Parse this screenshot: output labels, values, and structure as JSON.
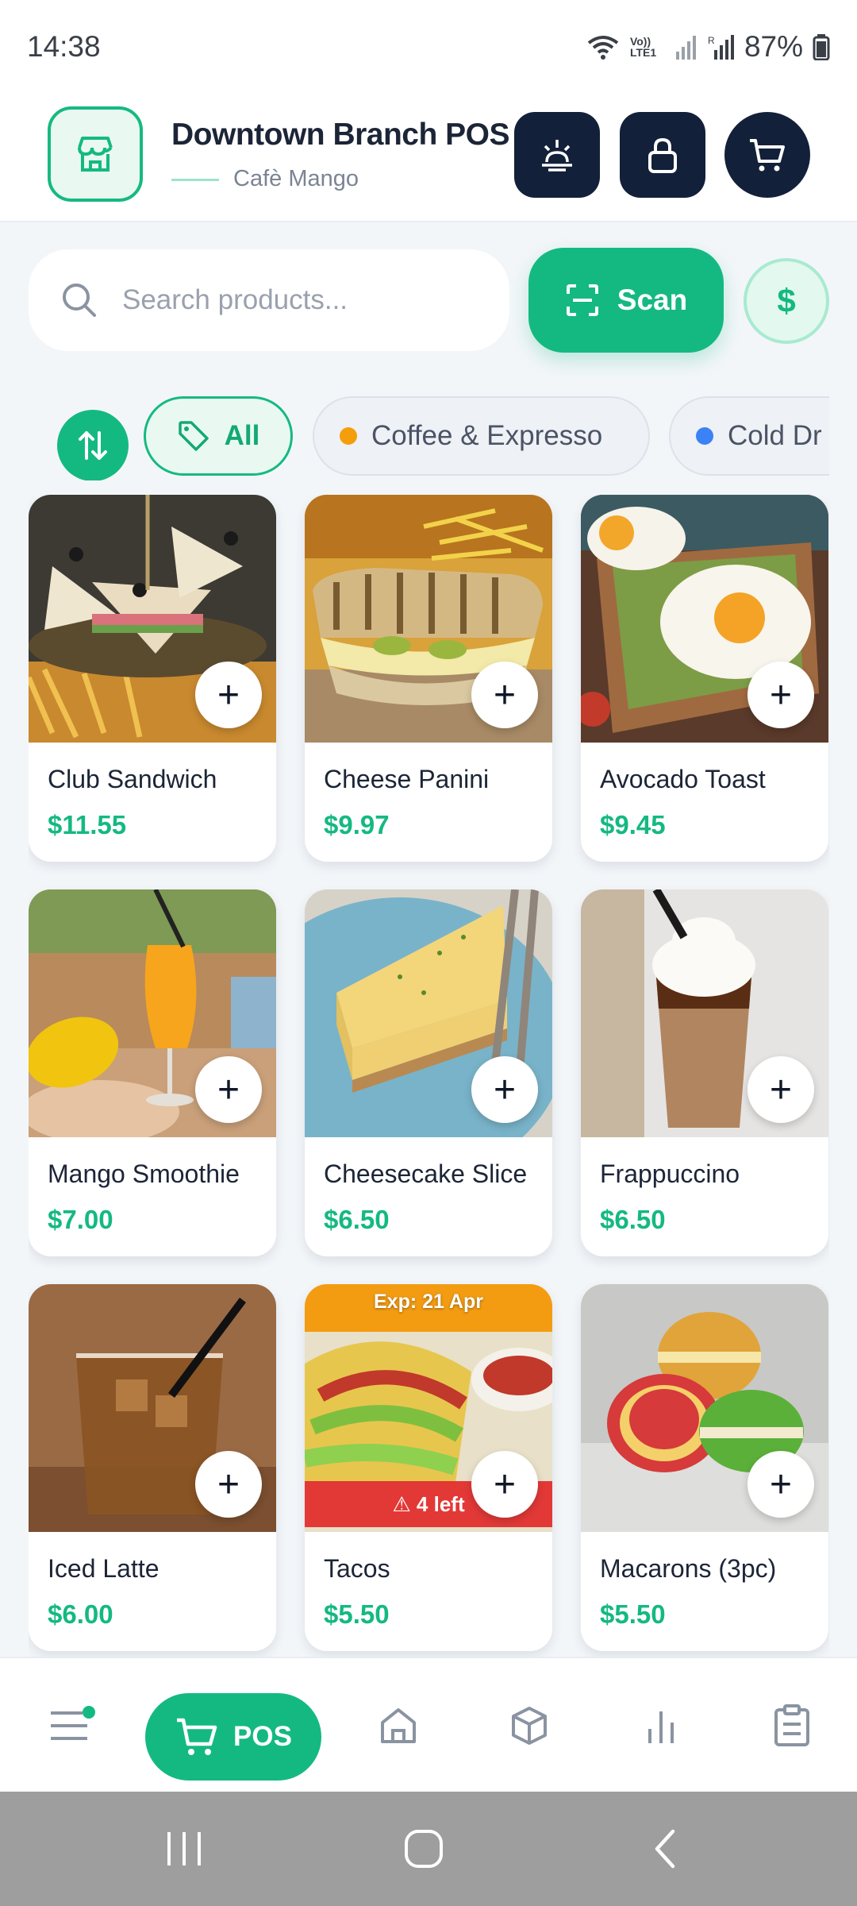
{
  "status_bar": {
    "time": "14:38",
    "battery": "87%",
    "network_label": "Vo)) LTE1"
  },
  "header": {
    "title": "Downtown Branch POS",
    "subtitle": "Cafè Mango",
    "icons": [
      "store-icon",
      "sunrise-icon",
      "lock-icon",
      "cart-icon"
    ]
  },
  "search": {
    "placeholder": "Search products...",
    "scan_label": "Scan",
    "currency_symbol": "$"
  },
  "filters": {
    "chips": [
      {
        "label": "All",
        "active": true
      },
      {
        "label": "Coffee & Expresso",
        "dot_color": "#f59e0b"
      },
      {
        "label": "Cold Dr",
        "dot_color": "#3b82f6"
      }
    ]
  },
  "products": [
    {
      "name": "Club Sandwich",
      "price": "$11.55"
    },
    {
      "name": "Cheese Panini",
      "price": "$9.97"
    },
    {
      "name": "Avocado Toast",
      "price": "$9.45"
    },
    {
      "name": "Mango Smoothie",
      "price": "$7.00"
    },
    {
      "name": "Cheesecake Slice",
      "price": "$6.50"
    },
    {
      "name": "Frappuccino",
      "price": "$6.50"
    },
    {
      "name": "Iced Latte",
      "price": "$6.00"
    },
    {
      "name": "Tacos",
      "price": "$5.50",
      "expiry": "Exp: 21 Apr",
      "stock_warning": "⚠ 4 left"
    },
    {
      "name": "Macarons (3pc)",
      "price": "$5.50"
    }
  ],
  "add_symbol": "+",
  "bottom_nav": {
    "pos_label": "POS",
    "items": [
      "menu-icon",
      "pos-cart-icon",
      "home-icon",
      "box-icon",
      "bar-chart-icon",
      "clipboard-icon"
    ]
  },
  "colors": {
    "accent": "#14b981",
    "dark_button": "#13203a",
    "warning": "#e12a2a"
  }
}
